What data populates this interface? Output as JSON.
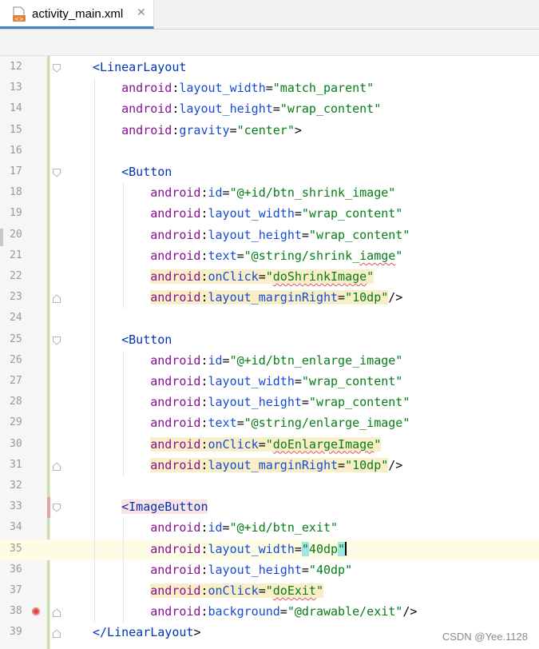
{
  "tab": {
    "title": "activity_main.xml",
    "close_glyph": "✕",
    "icon": "xml-file-icon"
  },
  "watermark": "CSDN @Yee.1128",
  "current_line": 35,
  "lines": [
    {
      "n": "12",
      "fold": "open",
      "indent": 1,
      "tokens": [
        [
          "tag",
          "<LinearLayout"
        ]
      ]
    },
    {
      "n": "13",
      "indent": 2,
      "tokens": [
        [
          "ns",
          "android"
        ],
        [
          "punc",
          ":"
        ],
        [
          "attr",
          "layout_width"
        ],
        [
          "punc",
          "="
        ],
        [
          "val",
          "\"match_parent\""
        ]
      ]
    },
    {
      "n": "14",
      "indent": 2,
      "tokens": [
        [
          "ns",
          "android"
        ],
        [
          "punc",
          ":"
        ],
        [
          "attr",
          "layout_height"
        ],
        [
          "punc",
          "="
        ],
        [
          "val",
          "\"wrap_content\""
        ]
      ]
    },
    {
      "n": "15",
      "indent": 2,
      "tokens": [
        [
          "ns",
          "android"
        ],
        [
          "punc",
          ":"
        ],
        [
          "attr",
          "gravity"
        ],
        [
          "punc",
          "="
        ],
        [
          "val",
          "\"center\""
        ],
        [
          "punc",
          ">"
        ]
      ]
    },
    {
      "n": "16",
      "indent": 0,
      "tokens": []
    },
    {
      "n": "17",
      "fold": "open",
      "indent": 2,
      "tokens": [
        [
          "tag",
          "<Button"
        ]
      ]
    },
    {
      "n": "18",
      "indent": 3,
      "tokens": [
        [
          "ns",
          "android"
        ],
        [
          "punc",
          ":"
        ],
        [
          "attr",
          "id"
        ],
        [
          "punc",
          "="
        ],
        [
          "val",
          "\"@+id/btn_shrink_image\""
        ]
      ]
    },
    {
      "n": "19",
      "indent": 3,
      "tokens": [
        [
          "ns",
          "android"
        ],
        [
          "punc",
          ":"
        ],
        [
          "attr",
          "layout_width"
        ],
        [
          "punc",
          "="
        ],
        [
          "val",
          "\"wrap_content\""
        ]
      ]
    },
    {
      "n": "20",
      "indent": 3,
      "tokens": [
        [
          "ns",
          "android"
        ],
        [
          "punc",
          ":"
        ],
        [
          "attr",
          "layout_height"
        ],
        [
          "punc",
          "="
        ],
        [
          "val",
          "\"wrap_content\""
        ]
      ]
    },
    {
      "n": "21",
      "indent": 3,
      "tokens": [
        [
          "ns",
          "android"
        ],
        [
          "punc",
          ":"
        ],
        [
          "attr",
          "text"
        ],
        [
          "punc",
          "="
        ],
        [
          "val",
          "\"@string/shrink_"
        ],
        [
          "valsq",
          "iamge"
        ],
        [
          "val",
          "\""
        ]
      ]
    },
    {
      "n": "22",
      "indent": 3,
      "hl": true,
      "tokens": [
        [
          "ns",
          "android"
        ],
        [
          "punc",
          ":"
        ],
        [
          "attr",
          "onClick"
        ],
        [
          "punc",
          "="
        ],
        [
          "val",
          "\""
        ],
        [
          "valsq",
          "doShrinkImage"
        ],
        [
          "val",
          "\""
        ]
      ]
    },
    {
      "n": "23",
      "fold": "close",
      "indent": 3,
      "hl": true,
      "tokens": [
        [
          "ns",
          "android"
        ],
        [
          "punc",
          ":"
        ],
        [
          "attr",
          "layout_marginRight"
        ],
        [
          "punc",
          "="
        ],
        [
          "val",
          "\"10dp\""
        ],
        [
          "puncnh",
          "/>"
        ]
      ]
    },
    {
      "n": "24",
      "indent": 0,
      "tokens": []
    },
    {
      "n": "25",
      "fold": "open",
      "indent": 2,
      "tokens": [
        [
          "tag",
          "<Button"
        ]
      ]
    },
    {
      "n": "26",
      "indent": 3,
      "tokens": [
        [
          "ns",
          "android"
        ],
        [
          "punc",
          ":"
        ],
        [
          "attr",
          "id"
        ],
        [
          "punc",
          "="
        ],
        [
          "val",
          "\"@+id/btn_enlarge_image\""
        ]
      ]
    },
    {
      "n": "27",
      "indent": 3,
      "tokens": [
        [
          "ns",
          "android"
        ],
        [
          "punc",
          ":"
        ],
        [
          "attr",
          "layout_width"
        ],
        [
          "punc",
          "="
        ],
        [
          "val",
          "\"wrap_content\""
        ]
      ]
    },
    {
      "n": "28",
      "indent": 3,
      "tokens": [
        [
          "ns",
          "android"
        ],
        [
          "punc",
          ":"
        ],
        [
          "attr",
          "layout_height"
        ],
        [
          "punc",
          "="
        ],
        [
          "val",
          "\"wrap_content\""
        ]
      ]
    },
    {
      "n": "29",
      "indent": 3,
      "tokens": [
        [
          "ns",
          "android"
        ],
        [
          "punc",
          ":"
        ],
        [
          "attr",
          "text"
        ],
        [
          "punc",
          "="
        ],
        [
          "val",
          "\"@string/enlarge_image\""
        ]
      ]
    },
    {
      "n": "30",
      "indent": 3,
      "hl": true,
      "tokens": [
        [
          "ns",
          "android"
        ],
        [
          "punc",
          ":"
        ],
        [
          "attr",
          "onClick"
        ],
        [
          "punc",
          "="
        ],
        [
          "val",
          "\""
        ],
        [
          "valsq",
          "doEnlargeImage"
        ],
        [
          "val",
          "\""
        ]
      ]
    },
    {
      "n": "31",
      "fold": "close",
      "indent": 3,
      "hl": true,
      "tokens": [
        [
          "ns",
          "android"
        ],
        [
          "punc",
          ":"
        ],
        [
          "attr",
          "layout_marginRight"
        ],
        [
          "punc",
          "="
        ],
        [
          "val",
          "\"10dp\""
        ],
        [
          "puncnh",
          "/>"
        ]
      ]
    },
    {
      "n": "32",
      "indent": 0,
      "tokens": []
    },
    {
      "n": "33",
      "fold": "open",
      "indent": 2,
      "tagerr": true,
      "tokens": [
        [
          "tagerr",
          "<ImageButton"
        ]
      ]
    },
    {
      "n": "34",
      "indent": 3,
      "tokens": [
        [
          "ns",
          "android"
        ],
        [
          "punc",
          ":"
        ],
        [
          "attr",
          "id"
        ],
        [
          "punc",
          "="
        ],
        [
          "val",
          "\"@+id/btn_exit\""
        ]
      ]
    },
    {
      "n": "35",
      "indent": 3,
      "tokens": [
        [
          "ns",
          "android"
        ],
        [
          "punc",
          ":"
        ],
        [
          "attr",
          "layout_width"
        ],
        [
          "punc",
          "="
        ],
        [
          "valq",
          "\""
        ],
        [
          "val",
          "40dp"
        ],
        [
          "valq",
          "\""
        ],
        [
          "caret",
          ""
        ]
      ]
    },
    {
      "n": "36",
      "indent": 3,
      "tokens": [
        [
          "ns",
          "android"
        ],
        [
          "punc",
          ":"
        ],
        [
          "attr",
          "layout_height"
        ],
        [
          "punc",
          "="
        ],
        [
          "val",
          "\"40dp\""
        ]
      ]
    },
    {
      "n": "37",
      "indent": 3,
      "hl": true,
      "tokens": [
        [
          "ns",
          "android"
        ],
        [
          "punc",
          ":"
        ],
        [
          "attr",
          "onClick"
        ],
        [
          "punc",
          "="
        ],
        [
          "val",
          "\""
        ],
        [
          "valsq",
          "doExit"
        ],
        [
          "val",
          "\""
        ]
      ]
    },
    {
      "n": "38",
      "fold": "close",
      "bp": true,
      "indent": 3,
      "tokens": [
        [
          "ns",
          "android"
        ],
        [
          "punc",
          ":"
        ],
        [
          "attr",
          "background"
        ],
        [
          "punc",
          "="
        ],
        [
          "val",
          "\"@drawable/exit\""
        ],
        [
          "punc",
          "/>"
        ]
      ]
    },
    {
      "n": "39",
      "fold": "close",
      "indent": 1,
      "tokens": [
        [
          "tag",
          "</LinearLayout"
        ],
        [
          "punc",
          ">"
        ]
      ]
    }
  ]
}
